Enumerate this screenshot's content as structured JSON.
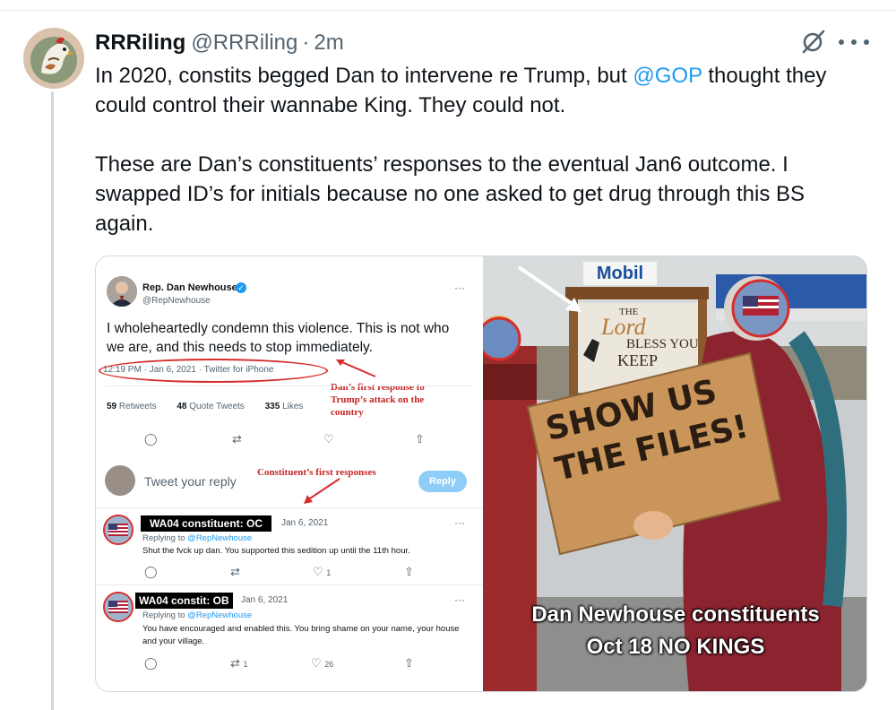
{
  "tweet": {
    "display_name": "RRRiling",
    "handle": "@RRRiling",
    "separator": "·",
    "time": "2m",
    "text_line1_pre": "In 2020, constits begged Dan to intervene re Trump, but ",
    "mention": "@GOP",
    "text_line1_post": " thought they could control their wannabe King. They could not.",
    "text_para2": "These are Dan’s constituents’ responses to the eventual Jan6 outcome. I swapped ID’s for initials because no one asked to get drug through this BS again."
  },
  "icons": {
    "grok": "grok-slash-icon",
    "more": "more-horizontal-icon"
  },
  "screenshot": {
    "name": "Rep. Dan Newhouse",
    "verified": "✓",
    "handle": "@RepNewhouse",
    "more": "···",
    "text": "I wholeheartedly condemn this violence. This is not who we are, and this needs to stop immediately.",
    "timestamp": "12:19 PM · Jan 6, 2021 · Twitter for iPhone",
    "retweets_n": "59",
    "retweets_label": "Retweets",
    "quotes_n": "48",
    "quotes_label": "Quote Tweets",
    "likes_n": "335",
    "likes_label": "Likes",
    "annotation_1_l1": "Dan’s first response to",
    "annotation_1_l2": "Trump’s attack on the",
    "annotation_1_l3": "country",
    "annotation_2": "Constituent’s first responses",
    "reply_placeholder": "Tweet your reply",
    "reply_button": "Reply",
    "replies": [
      {
        "label": "WA04 constituent: OC",
        "date": "Jan 6, 2021",
        "replying_prefix": "Replying to ",
        "replying_to": "@RepNewhouse",
        "body": "Shut the fvck up dan. You supported this sedition up until the 11th hour.",
        "retweets": "",
        "likes": "1"
      },
      {
        "label": "WA04 constit:  OB",
        "date": "Jan 6, 2021",
        "replying_prefix": "Replying to ",
        "replying_to": "@RepNewhouse",
        "body": "You have encouraged and enabled this. You bring shame on your name, your house and your village.",
        "retweets": "1",
        "likes": "26"
      }
    ]
  },
  "photo": {
    "mobil": "Mobil",
    "church_sign_1": "THE",
    "church_sign_2": "Lord",
    "church_sign_3": "BLESS YOU",
    "church_sign_4": "KEEP",
    "sign_line1": "SHOW US",
    "sign_line2": "THE FILES!",
    "caption_line1": "Dan Newhouse constituents",
    "caption_line2": "Oct 18 NO KINGS"
  },
  "colors": {
    "link": "#1d9bf0",
    "annotation_red": "#c62424",
    "secondary_text": "#536471"
  }
}
